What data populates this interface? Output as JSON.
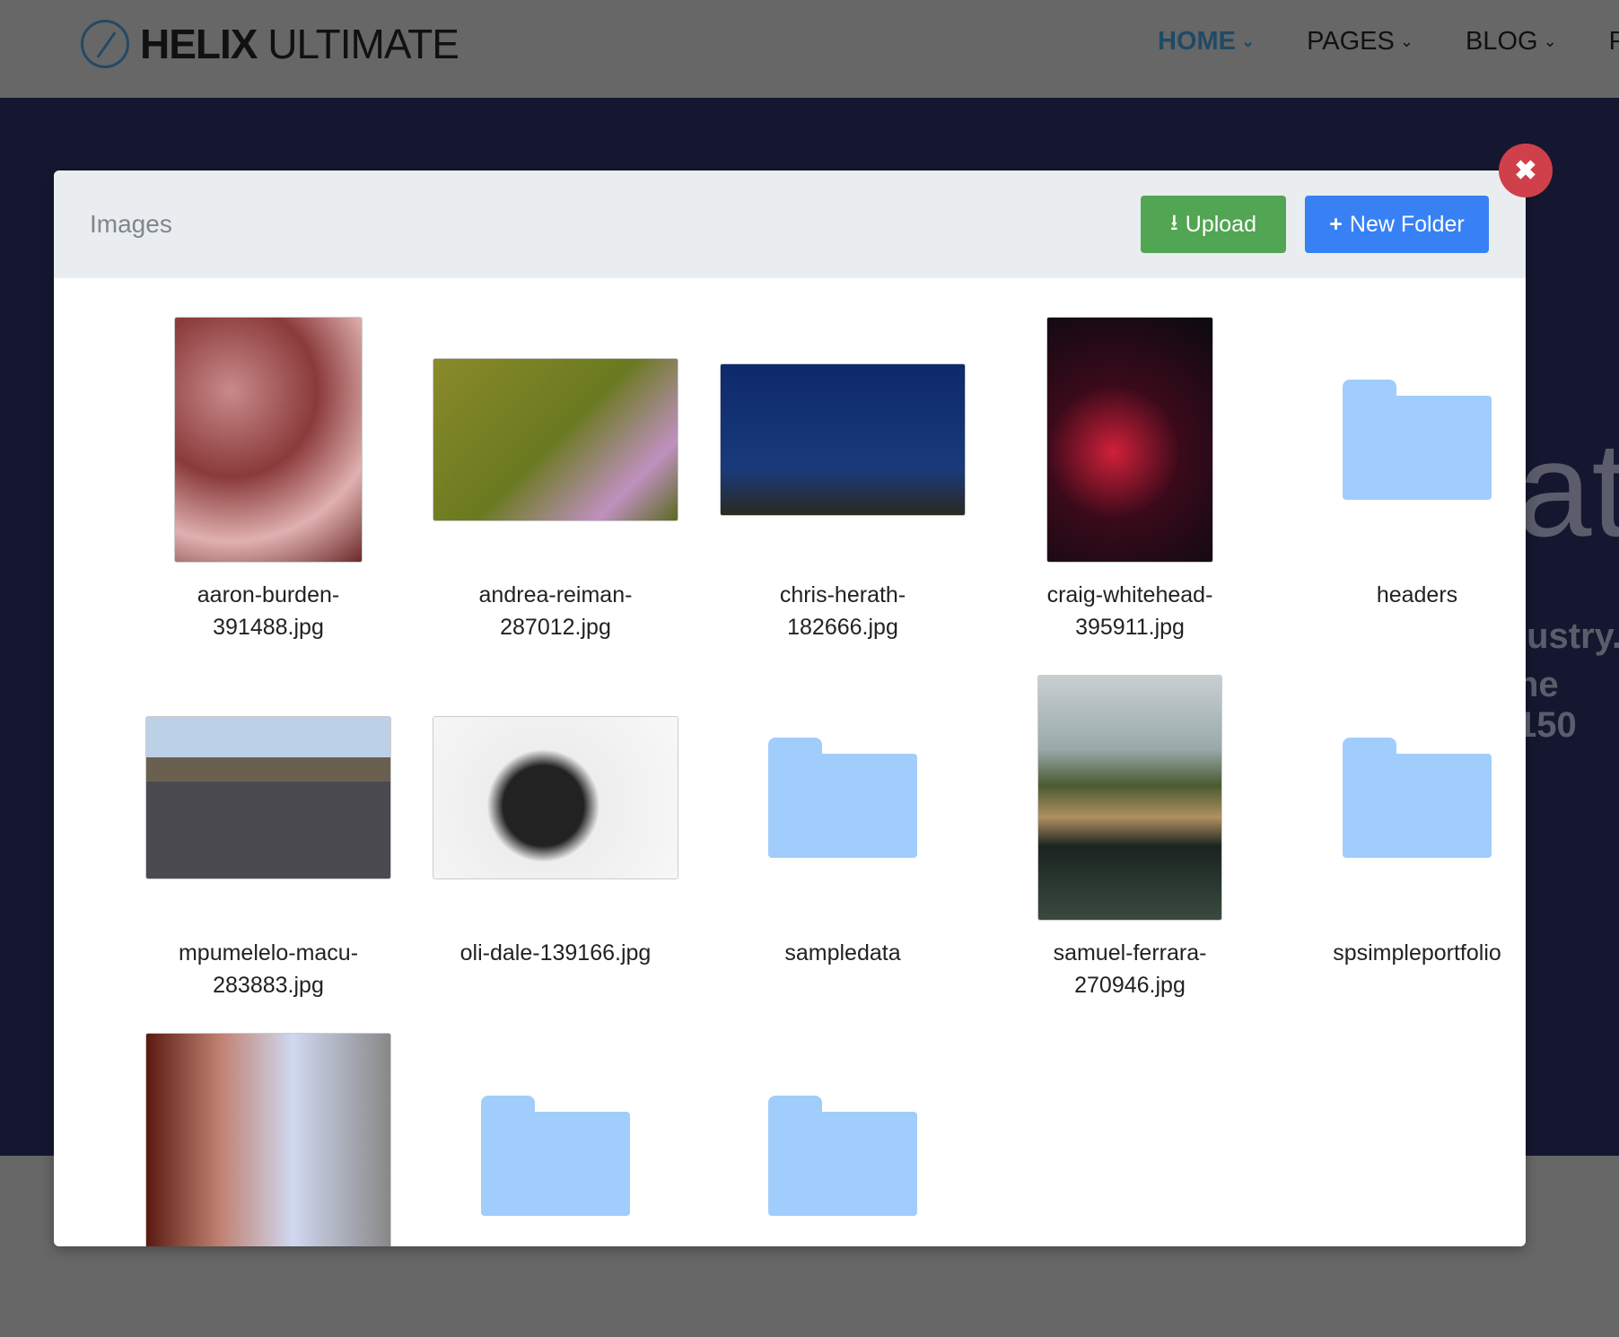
{
  "site": {
    "logo_bold": "HELIX",
    "logo_light": "ULTIMATE",
    "nav": [
      {
        "label": "HOME",
        "active": true
      },
      {
        "label": "PAGES"
      },
      {
        "label": "BLOG"
      },
      {
        "label": "PO"
      }
    ],
    "hero_fragments": [
      "at",
      "lustry.",
      "ne 150"
    ]
  },
  "modal": {
    "title": "Images",
    "upload_label": "Upload",
    "new_folder_label": "New Folder",
    "close_icon": "times-icon",
    "items": [
      {
        "name": "aaron-burden-391488.jpg",
        "l1": "aaron-burden-",
        "l2": "391488.jpg",
        "type": "image"
      },
      {
        "name": "andrea-reiman-287012.jpg",
        "l1": "andrea-reiman-",
        "l2": "287012.jpg",
        "type": "image"
      },
      {
        "name": "chris-herath-182666.jpg",
        "l1": "chris-herath-",
        "l2": "182666.jpg",
        "type": "image"
      },
      {
        "name": "craig-whitehead-395911.jpg",
        "l1": "craig-whitehead-",
        "l2": "395911.jpg",
        "type": "image"
      },
      {
        "name": "headers",
        "l1": "headers",
        "l2": "",
        "type": "folder"
      },
      {
        "name": "mpumelelo-macu-283883.jpg",
        "l1": "mpumelelo-macu-",
        "l2": "283883.jpg",
        "type": "image"
      },
      {
        "name": "oli-dale-139166.jpg",
        "l1": "oli-dale-139166.jpg",
        "l2": "",
        "type": "image"
      },
      {
        "name": "sampledata",
        "l1": "sampledata",
        "l2": "",
        "type": "folder"
      },
      {
        "name": "samuel-ferrara-270946.jpg",
        "l1": "samuel-ferrara-",
        "l2": "270946.jpg",
        "type": "image"
      },
      {
        "name": "spsimpleportfolio",
        "l1": "spsimpleportfolio",
        "l2": "",
        "type": "folder"
      },
      {
        "l1": "",
        "l2": "",
        "type": "image"
      },
      {
        "l1": "",
        "l2": "",
        "type": "folder"
      },
      {
        "l1": "",
        "l2": "",
        "type": "folder"
      }
    ]
  }
}
